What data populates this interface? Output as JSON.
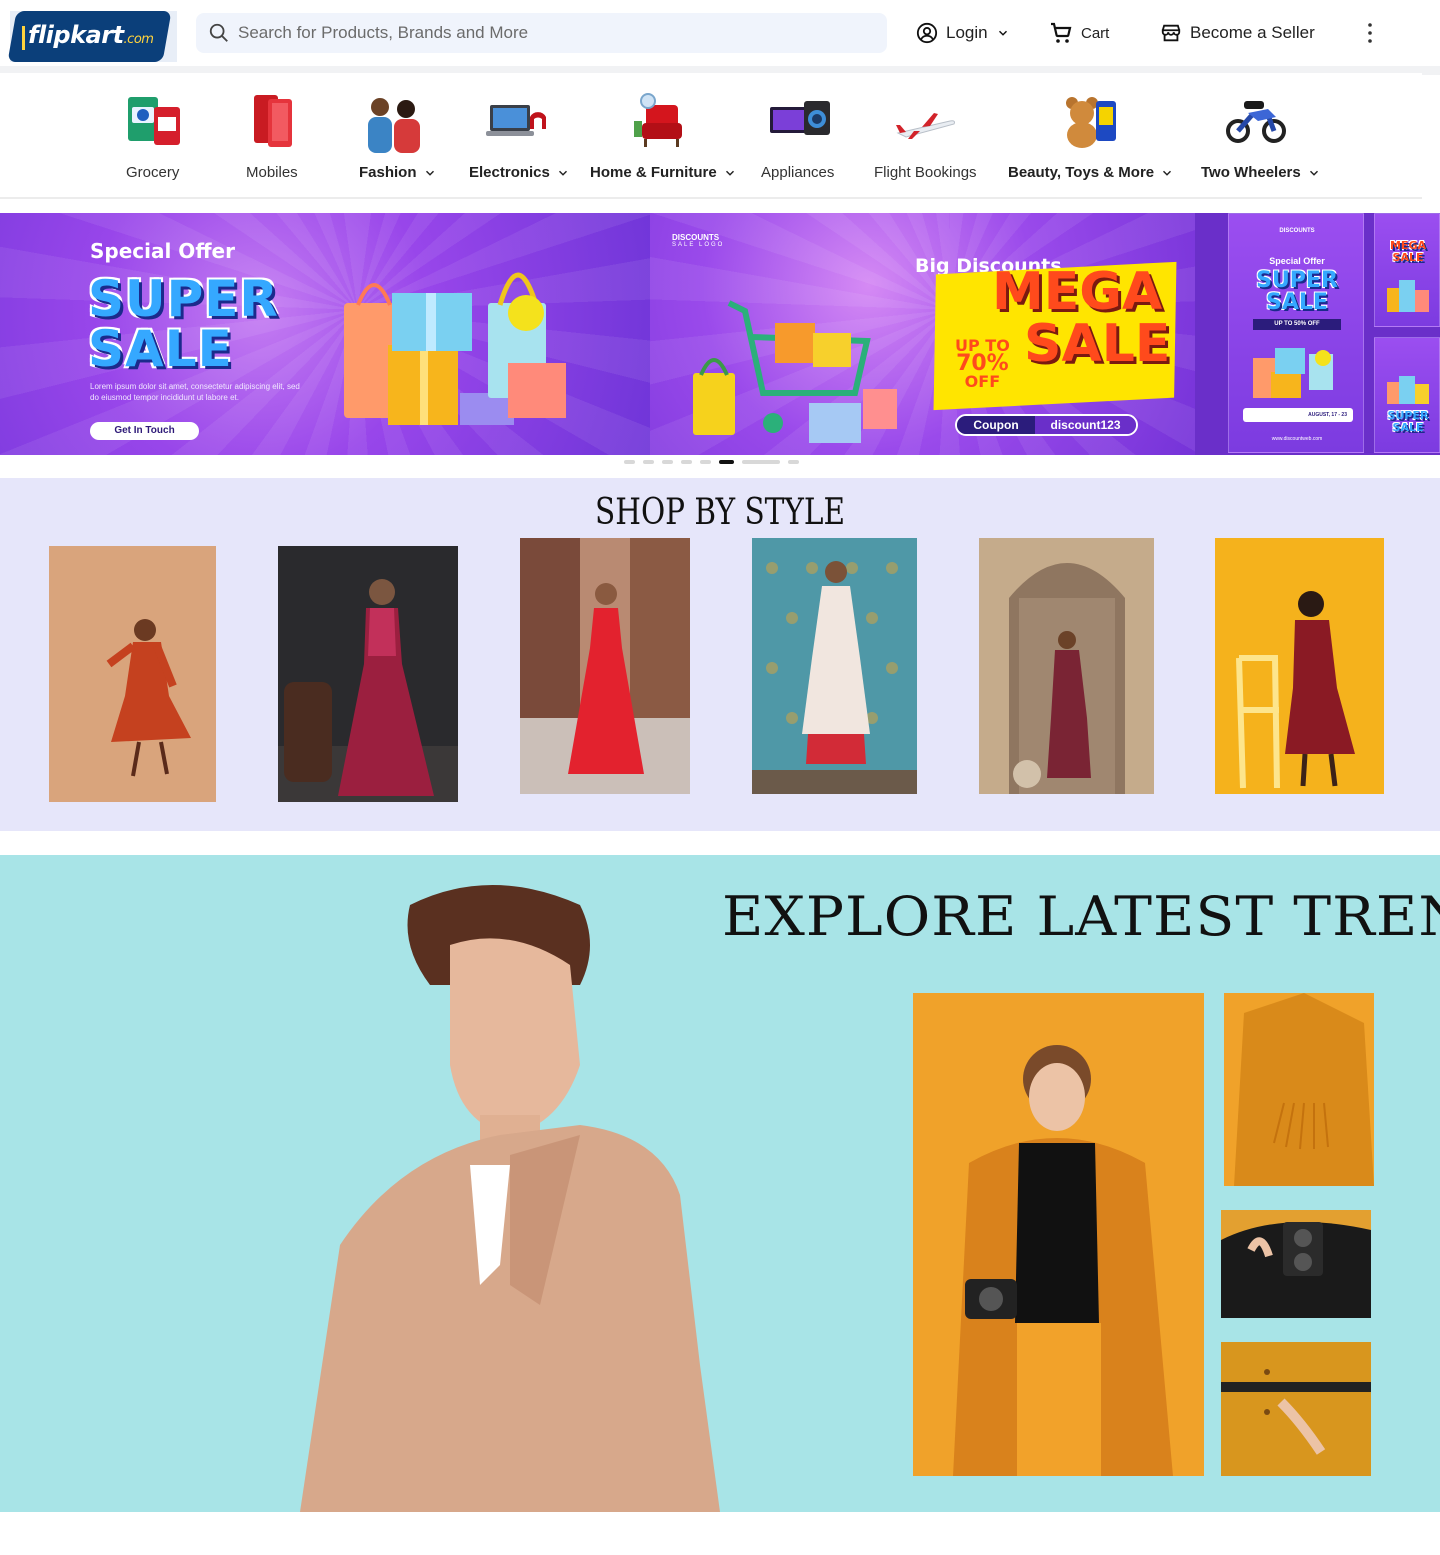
{
  "header": {
    "logo_text": "flipkart",
    "logo_suffix": ".com",
    "search_placeholder": "Search for Products, Brands and More",
    "login_label": "Login",
    "cart_label": "Cart",
    "seller_label": "Become a Seller"
  },
  "categories": [
    {
      "label": "Grocery",
      "has_dropdown": false
    },
    {
      "label": "Mobiles",
      "has_dropdown": false
    },
    {
      "label": "Fashion",
      "has_dropdown": true
    },
    {
      "label": "Electronics",
      "has_dropdown": true
    },
    {
      "label": "Home & Furniture",
      "has_dropdown": true
    },
    {
      "label": "Appliances",
      "has_dropdown": false
    },
    {
      "label": "Flight Bookings",
      "has_dropdown": false
    },
    {
      "label": "Beauty, Toys & More",
      "has_dropdown": true
    },
    {
      "label": "Two Wheelers",
      "has_dropdown": true
    }
  ],
  "banner": {
    "slide1": {
      "offer": "Special Offer",
      "line1": "SUPER",
      "line2": "SALE",
      "body": "Lorem ipsum dolor sit amet, consectetur adipiscing elit, sed do eiusmod tempor incididunt ut labore et.",
      "cta": "Get In Touch"
    },
    "slide2": {
      "brand": "DISCOUNTS",
      "brand_sub": "SALE LOGO",
      "headline": "Big Discounts",
      "mega": "MEGA",
      "sale": "SALE",
      "upto": "UP TO",
      "percent": "70%",
      "off": "OFF",
      "coupon_label": "Coupon",
      "coupon_code": "discount123"
    },
    "slide3": {
      "brand": "DISCOUNTS",
      "offer": "Special Offer",
      "line1": "SUPER",
      "line2": "SALE",
      "tag": "UP TO 50% OFF",
      "date": "AUGUST, 17 - 23",
      "site": "www.discountweb.com"
    },
    "slide4": {
      "mini1": "MEGA SALE",
      "mini2": "SUPER SALE"
    },
    "dot_count": 8,
    "active_dot": 5
  },
  "shop_by_style": {
    "title": "SHOP BY STYLE"
  },
  "trends": {
    "title": "EXPLORE LATEST TRENDS"
  },
  "colors": {
    "brand_blue": "#0b3f7a",
    "brand_yellow": "#ffd33d",
    "banner_purple": "#8a45e6",
    "style_bg": "#e6e6fa",
    "trends_bg": "#a8e4e7"
  }
}
